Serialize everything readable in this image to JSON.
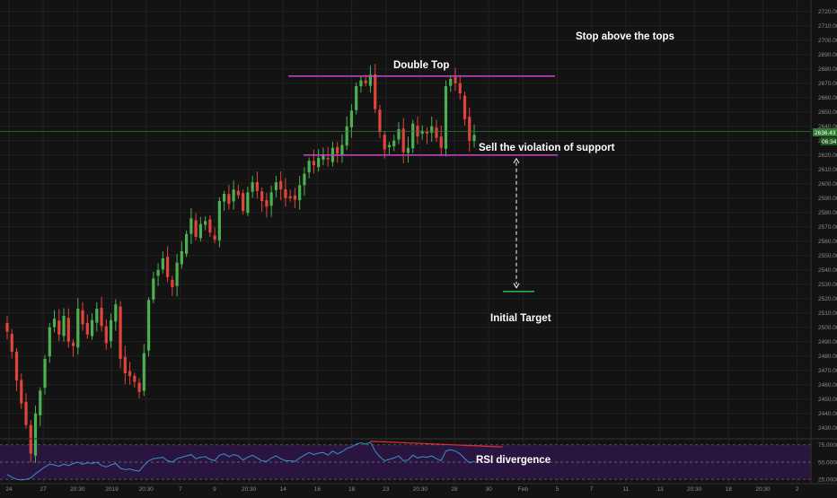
{
  "colors": {
    "background": "#131313",
    "grid": "#222222",
    "bull": "#4caf50",
    "bear": "#e0443a",
    "resistance_line": "#c040c0",
    "support_line": "#c040c0",
    "target_line": "#22b14c",
    "rsi_line": "#3d8fd4",
    "rsi_band": "#2a1540",
    "divergence_line": "#e03030",
    "price_badge": "#2e7d32"
  },
  "chart_data": [
    {
      "type": "candlestick",
      "title": "",
      "ylim": [
        2423,
        2728
      ],
      "y_ticks": [
        "2720.00",
        "2710.00",
        "2700.00",
        "2690.00",
        "2680.00",
        "2670.00",
        "2660.00",
        "2650.00",
        "2640.00",
        "2630.00",
        "2620.00",
        "2610.00",
        "2600.00",
        "2590.00",
        "2580.00",
        "2570.00",
        "2560.00",
        "2550.00",
        "2540.00",
        "2530.00",
        "2520.00",
        "2510.00",
        "2500.00",
        "2490.00",
        "2480.00",
        "2470.00",
        "2460.00",
        "2450.00",
        "2440.00",
        "2430.00"
      ],
      "x_ticks": [
        "24",
        "27",
        "20:30",
        "2019",
        "20:30",
        "7",
        "9",
        "20:30",
        "14",
        "16",
        "18",
        "23",
        "20:30",
        "28",
        "30",
        "Feb",
        "5",
        "7",
        "11",
        "13",
        "20:30",
        "18",
        "20:30",
        "2"
      ],
      "last_price": "2636.43",
      "last_price_sub": "06:34",
      "closes": [
        2497,
        2483,
        2463,
        2447,
        2432,
        2412,
        2440,
        2456,
        2478,
        2500,
        2506,
        2495,
        2508,
        2490,
        2487,
        2513,
        2502,
        2495,
        2505,
        2513,
        2501,
        2489,
        2505,
        2516,
        2478,
        2468,
        2466,
        2462,
        2455,
        2482,
        2519,
        2534,
        2540,
        2548,
        2535,
        2528,
        2545,
        2553,
        2565,
        2576,
        2563,
        2572,
        2574,
        2566,
        2561,
        2588,
        2593,
        2586,
        2596,
        2592,
        2581,
        2594,
        2601,
        2595,
        2588,
        2584,
        2594,
        2601,
        2596,
        2590,
        2590,
        2589,
        2599,
        2607,
        2616,
        2613,
        2618,
        2620,
        2617,
        2625,
        2621,
        2627,
        2640,
        2651,
        2668,
        2672,
        2670,
        2676,
        2652,
        2636,
        2624,
        2627,
        2630,
        2638,
        2622,
        2625,
        2642,
        2633,
        2637,
        2635,
        2640,
        2632,
        2625,
        2668,
        2673,
        2670,
        2663,
        2645,
        2630,
        2634
      ],
      "levels": {
        "double_top": 2675,
        "support": 2620,
        "initial_target": 2525
      },
      "annotations": {
        "double_top": "Double Top",
        "stop": "Stop above the tops",
        "sell": "Sell the violation of support",
        "target": "Initial Target"
      }
    },
    {
      "type": "line",
      "title": "",
      "ylim": [
        20,
        80
      ],
      "y_ticks": [
        "75.0000",
        "50.0000",
        "25.0000"
      ],
      "rsi_values": [
        32,
        28,
        25,
        24,
        25,
        27,
        33,
        38,
        43,
        47,
        46,
        44,
        47,
        45,
        48,
        50,
        47,
        49,
        48,
        50,
        45,
        43,
        46,
        48,
        41,
        39,
        40,
        38,
        37,
        45,
        52,
        55,
        56,
        57,
        52,
        50,
        55,
        57,
        59,
        61,
        55,
        57,
        58,
        54,
        52,
        60,
        62,
        58,
        61,
        59,
        53,
        57,
        60,
        56,
        52,
        51,
        56,
        59,
        55,
        52,
        52,
        51,
        56,
        60,
        64,
        61,
        63,
        64,
        60,
        66,
        62,
        65,
        70,
        72,
        76,
        78,
        76,
        79,
        66,
        58,
        52,
        54,
        56,
        59,
        52,
        53,
        60,
        56,
        58,
        57,
        59,
        55,
        52,
        66,
        68,
        66,
        62,
        55,
        49,
        51
      ],
      "annotations": {
        "divergence": "RSI divergence"
      }
    }
  ]
}
